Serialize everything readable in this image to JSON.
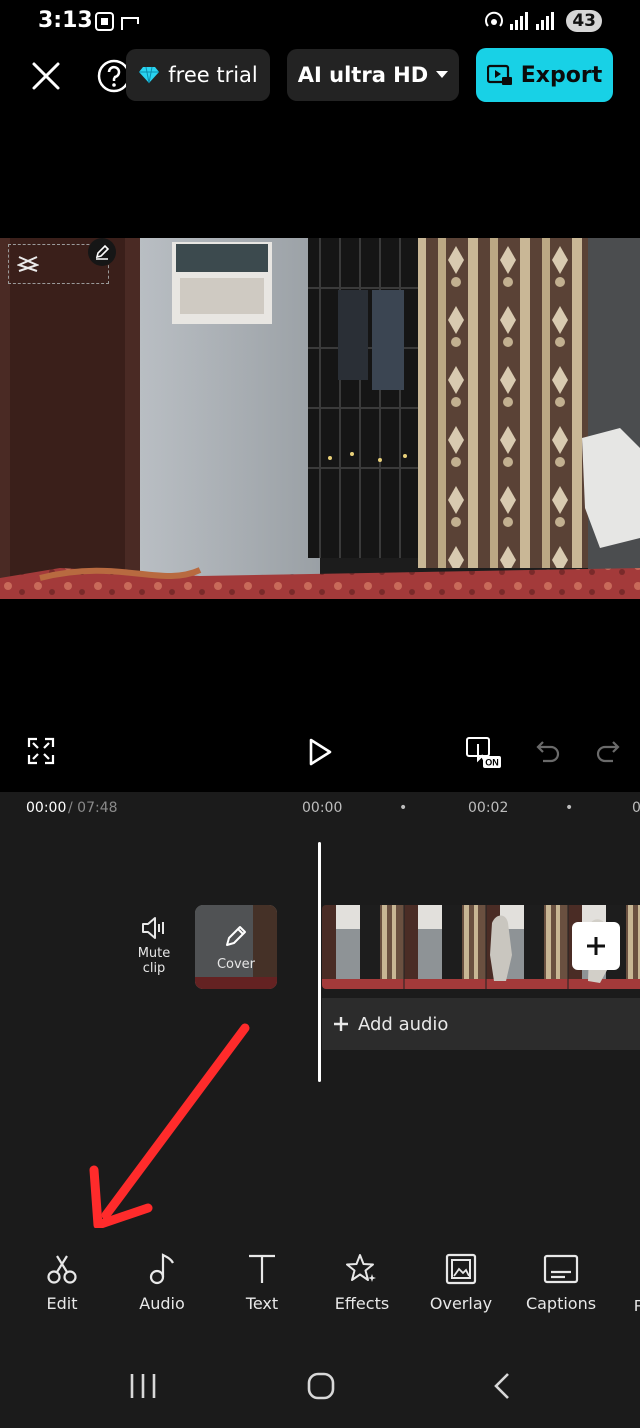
{
  "status_bar": {
    "time": "3:13",
    "battery": "43"
  },
  "top_bar": {
    "trial_label": "free trial",
    "quality_label": "AI ultra HD",
    "export_label": "Export"
  },
  "player": {
    "current_time": "00:00",
    "total_time": "/ 07:48",
    "ruler_marks": [
      "00:00",
      "00:02"
    ],
    "ruler_dot": "•",
    "ruler_partial": "0"
  },
  "track": {
    "mute_label_1": "Mute",
    "mute_label_2": "clip",
    "cover_label": "Cover",
    "add_audio_label": "Add audio"
  },
  "toolbar": {
    "items": [
      {
        "label": "Edit",
        "icon": "scissors-icon"
      },
      {
        "label": "Audio",
        "icon": "music-note-icon"
      },
      {
        "label": "Text",
        "icon": "text-icon"
      },
      {
        "label": "Effects",
        "icon": "sparkle-star-icon"
      },
      {
        "label": "Overlay",
        "icon": "overlay-image-icon"
      },
      {
        "label": "Captions",
        "icon": "captions-icon"
      }
    ]
  },
  "annotation": {
    "arrow_color": "#ff2b2b"
  },
  "colors": {
    "accent": "#18d1e6"
  }
}
